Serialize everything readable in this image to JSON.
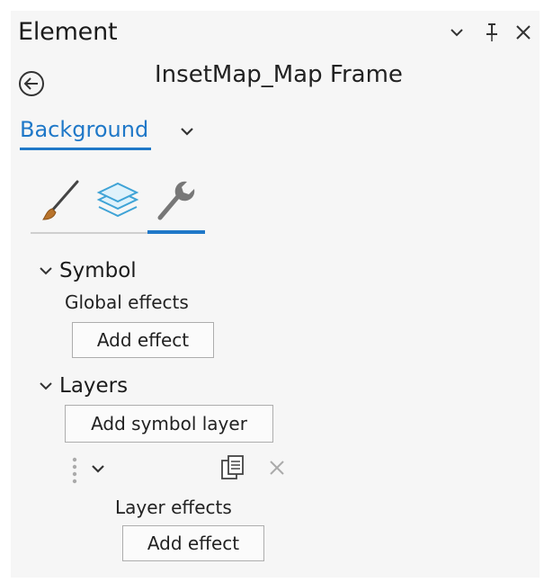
{
  "header": {
    "title": "Element",
    "controls": {
      "options": "chevron-down-icon",
      "pin": "pin-icon",
      "close": "close-icon"
    }
  },
  "element": {
    "name": "InsetMap_Map Frame",
    "back_icon": "back-arrow-icon"
  },
  "dropdown": {
    "selected": "Background"
  },
  "tabs": [
    {
      "icon": "paintbrush-icon",
      "active": false
    },
    {
      "icon": "layers-icon",
      "active": false
    },
    {
      "icon": "wrench-icon",
      "active": true
    }
  ],
  "symbol": {
    "heading": "Symbol",
    "global_effects_label": "Global effects",
    "add_effect_label": "Add effect"
  },
  "layers": {
    "heading": "Layers",
    "add_symbol_layer_label": "Add symbol layer",
    "layer_effects_label": "Layer effects",
    "add_effect_label": "Add effect",
    "row_icons": [
      "drag-handle-icon",
      "chevron-down-icon",
      "duplicate-icon",
      "delete-icon"
    ]
  },
  "colors": {
    "accent": "#1f78c8",
    "panel_bg": "#f6f6f6"
  }
}
